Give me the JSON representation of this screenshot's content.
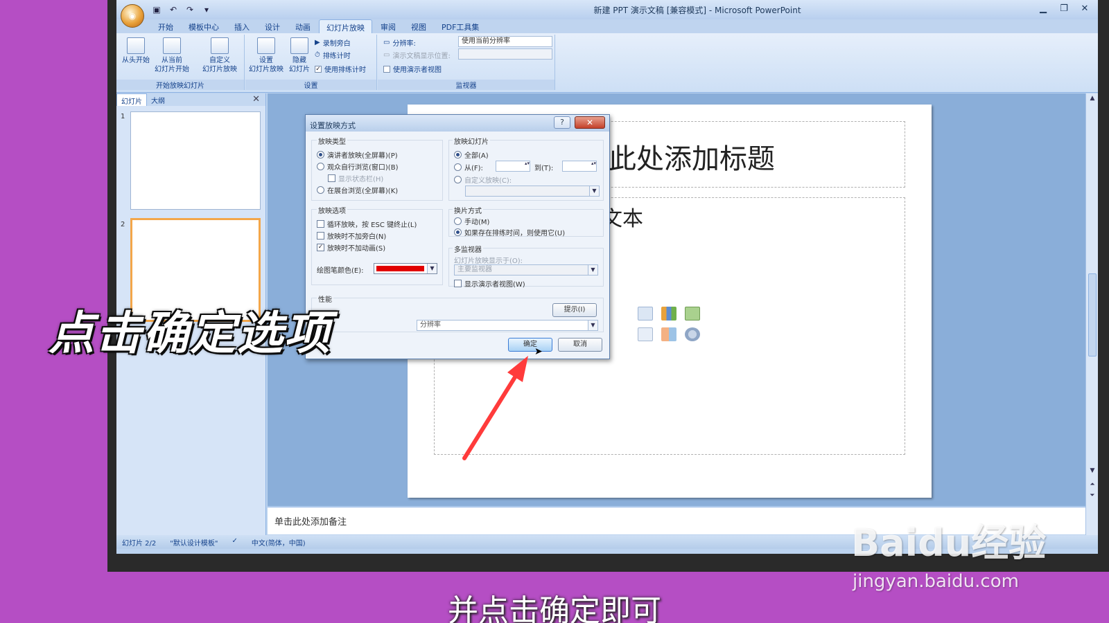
{
  "app": {
    "title": "新建 PPT 演示文稿 [兼容模式] - Microsoft PowerPoint",
    "tabs": [
      "开始",
      "模板中心",
      "插入",
      "设计",
      "动画",
      "幻灯片放映",
      "审阅",
      "视图",
      "PDF工具集"
    ],
    "active_tab": "幻灯片放映"
  },
  "ribbon": {
    "group_start": {
      "label": "开始放映幻灯片",
      "from_start": "从头开始",
      "from_current_1": "从当前",
      "from_current_2": "幻灯片开始",
      "custom_1": "自定义",
      "custom_2": "幻灯片放映"
    },
    "group_setup": {
      "label": "设置",
      "setup_1": "设置",
      "setup_2": "幻灯片放映",
      "hide_1": "隐藏",
      "hide_2": "幻灯片",
      "record": "录制旁白",
      "rehearse": "排练计时",
      "use_timings": "使用排练计时"
    },
    "group_monitor": {
      "label": "监视器",
      "resolution_label": "分辨率:",
      "resolution_value": "使用当前分辨率",
      "show_on_label": "演示文稿显示位置:",
      "presenter_view": "使用演示者视图"
    }
  },
  "left_pane": {
    "tab_slides": "幻灯片",
    "tab_outline": "大纲",
    "slide1_num": "1",
    "slide2_num": "2"
  },
  "slide": {
    "title": "此处添加标题",
    "body": "文本"
  },
  "notes": "单击此处添加备注",
  "status": {
    "slide_pos": "幻灯片 2/2",
    "theme": "\"默认设计模板\"",
    "language": "中文(简体，中国)"
  },
  "dialog": {
    "title": "设置放映方式",
    "help": "?",
    "close": "✕",
    "show_type": {
      "label": "放映类型",
      "presenter": "演讲者放映(全屏幕)(P)",
      "browsed_window": "观众自行浏览(窗口)(B)",
      "show_scrollbar": "显示状态栏(H)",
      "kiosk": "在展台浏览(全屏幕)(K)"
    },
    "show_slides": {
      "label": "放映幻灯片",
      "all": "全部(A)",
      "from": "从(F):",
      "to": "到(T):",
      "custom": "自定义放映(C):"
    },
    "show_options": {
      "label": "放映选项",
      "loop": "循环放映，按 ESC 键终止(L)",
      "no_narration": "放映时不加旁白(N)",
      "no_animation": "放映时不加动画(S)",
      "pen_color": "绘图笔颜色(E):",
      "pen_color_value": "#e10000"
    },
    "advance": {
      "label": "换片方式",
      "manual": "手动(M)",
      "timings": "如果存在排练时间，则使用它(U)"
    },
    "multi_monitor": {
      "label": "多监视器",
      "show_on": "幻灯片放映显示于(O):",
      "monitor": "主要监视器",
      "presenter_view": "显示演示者视图(W)"
    },
    "performance": {
      "label": "性能",
      "tips": "提示(I)",
      "resolution": "分辨率"
    },
    "ok": "确定",
    "cancel": "取消"
  },
  "overlay": {
    "caption": "点击确定选项",
    "subtitle": "并点击确定即可",
    "watermark_logo": "Baidu经验",
    "watermark_url": "jingyan.baidu.com"
  }
}
